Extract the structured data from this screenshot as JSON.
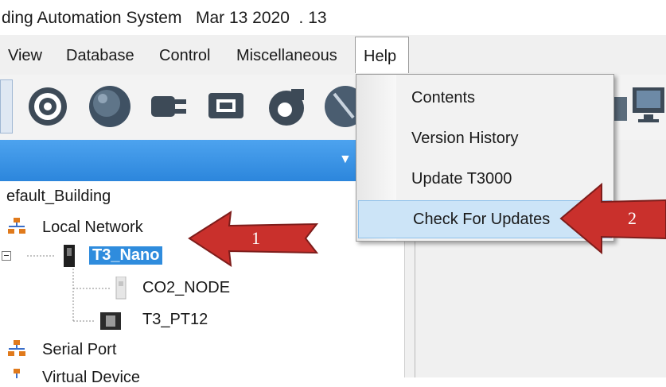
{
  "window": {
    "title": "ding Automation System   Mar 13 2020  . 13"
  },
  "menu": {
    "items": [
      "View",
      "Database",
      "Control",
      "Miscellaneous"
    ],
    "help": "Help"
  },
  "help_menu": {
    "items": [
      "Contents",
      "Version History",
      "Update T3000",
      "Check For Updates"
    ]
  },
  "tree": {
    "root": "efault_Building",
    "local_network": "Local Network",
    "selected_device": "T3_Nano",
    "child_1": "CO2_NODE",
    "child_2": "T3_PT12",
    "serial_port": "Serial Port",
    "virtual_device": "Virtual Device"
  },
  "callouts": {
    "one": "1",
    "two": "2"
  },
  "colors": {
    "accent": "#2f8cdd",
    "arrow": "#c9302c",
    "highlight": "#cce4f7"
  }
}
